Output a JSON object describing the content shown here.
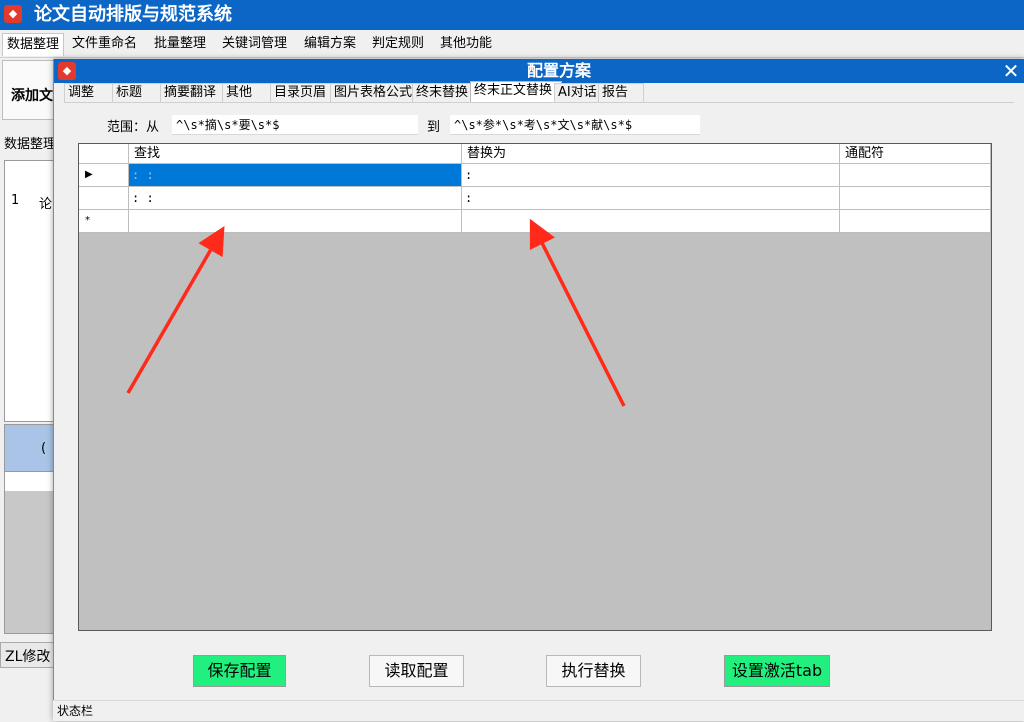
{
  "app": {
    "title": "论文自动排版与规范系统",
    "logo_text": "◆"
  },
  "main_menu": [
    "数据整理",
    "文件重命名",
    "批量整理",
    "关键词管理",
    "编辑方案",
    "判定规则",
    "其他功能"
  ],
  "background": {
    "add_button": "添加文",
    "section_label": "数据整理",
    "grid_row_number": "1",
    "grid_row_text": "论",
    "grid2_header": "(",
    "zl_button": "ZL修改"
  },
  "dialog": {
    "title": "配置方案",
    "close": "✕",
    "tabs": [
      "调整",
      "标题",
      "摘要翻译",
      "其他",
      "目录页眉",
      "图片表格公式",
      "终末替换",
      "终末正文替换",
      "AI对话",
      "报告"
    ],
    "active_tab": "终末正文替换",
    "range": {
      "label_from": "范围：从",
      "from_value": "^\\s*摘\\s*要\\s*$",
      "label_to": "到",
      "to_value": "^\\s*参*\\s*考\\s*文\\s*献\\s*$"
    },
    "grid": {
      "columns": [
        "查找",
        "替换为",
        "通配符"
      ],
      "rows": [
        {
          "marker": "▶",
          "find": ": :",
          "replace": ":",
          "wildcard": ""
        },
        {
          "marker": "",
          "find": ": :",
          "replace": ":",
          "wildcard": ""
        },
        {
          "marker": "*",
          "find": "",
          "replace": "",
          "wildcard": ""
        }
      ]
    },
    "buttons": {
      "save": "保存配置",
      "load": "读取配置",
      "execute": "执行替换",
      "activate": "设置激活tab"
    },
    "status": "状态栏"
  },
  "colors": {
    "title_bar": "#0b66c6",
    "accent_green": "#22f07e",
    "selection": "#0078d7",
    "arrow": "#ff2a1a"
  }
}
